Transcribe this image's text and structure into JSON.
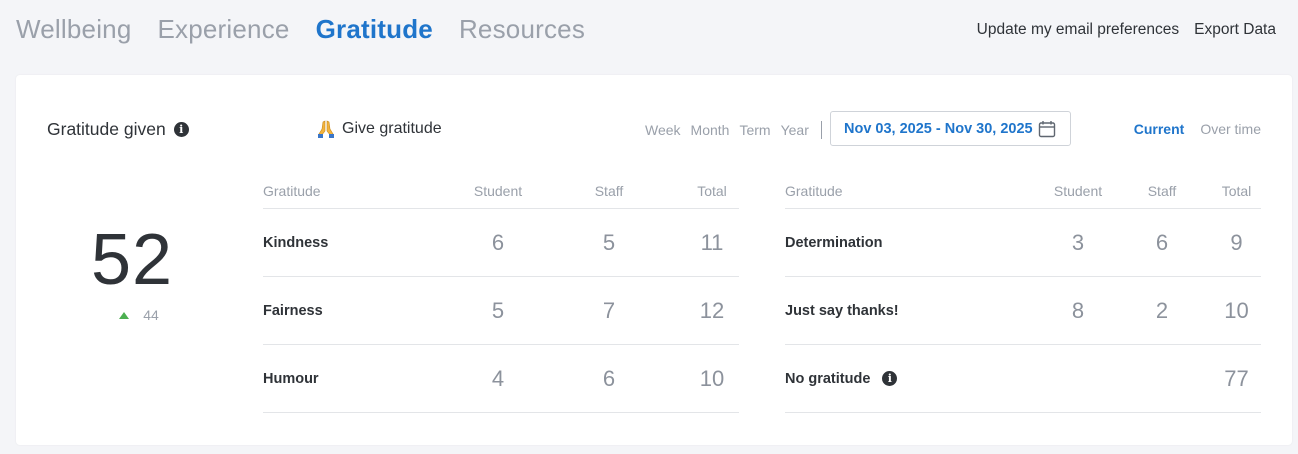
{
  "nav": {
    "tabs": [
      {
        "label": "Wellbeing"
      },
      {
        "label": "Experience"
      },
      {
        "label": "Gratitude"
      },
      {
        "label": "Resources"
      }
    ],
    "active_tab": "Gratitude",
    "links": {
      "email_prefs": "Update my email preferences",
      "export": "Export Data"
    }
  },
  "card": {
    "title": "Gratitude given",
    "give_label": "Give gratitude",
    "periods": [
      "Week",
      "Month",
      "Term",
      "Year"
    ],
    "date_range": "Nov 03, 2025 - Nov 30, 2025",
    "views": {
      "current": "Current",
      "over_time": "Over time"
    },
    "active_view": "Current",
    "total": "52",
    "delta": "44"
  },
  "table_headers": {
    "gratitude": "Gratitude",
    "student": "Student",
    "staff": "Staff",
    "total": "Total"
  },
  "left_rows": [
    {
      "name": "Kindness",
      "student": "6",
      "staff": "5",
      "total": "11"
    },
    {
      "name": "Fairness",
      "student": "5",
      "staff": "7",
      "total": "12"
    },
    {
      "name": "Humour",
      "student": "4",
      "staff": "6",
      "total": "10"
    }
  ],
  "right_rows": [
    {
      "name": "Determination",
      "student": "3",
      "staff": "6",
      "total": "9"
    },
    {
      "name": "Just say thanks!",
      "student": "8",
      "staff": "2",
      "total": "10"
    },
    {
      "name": "No gratitude",
      "student": "",
      "staff": "",
      "total": "77"
    }
  ],
  "colors": {
    "accent": "#1f75cb",
    "muted": "#9aa0aa",
    "text": "#2f3338",
    "up": "#4caf50"
  }
}
